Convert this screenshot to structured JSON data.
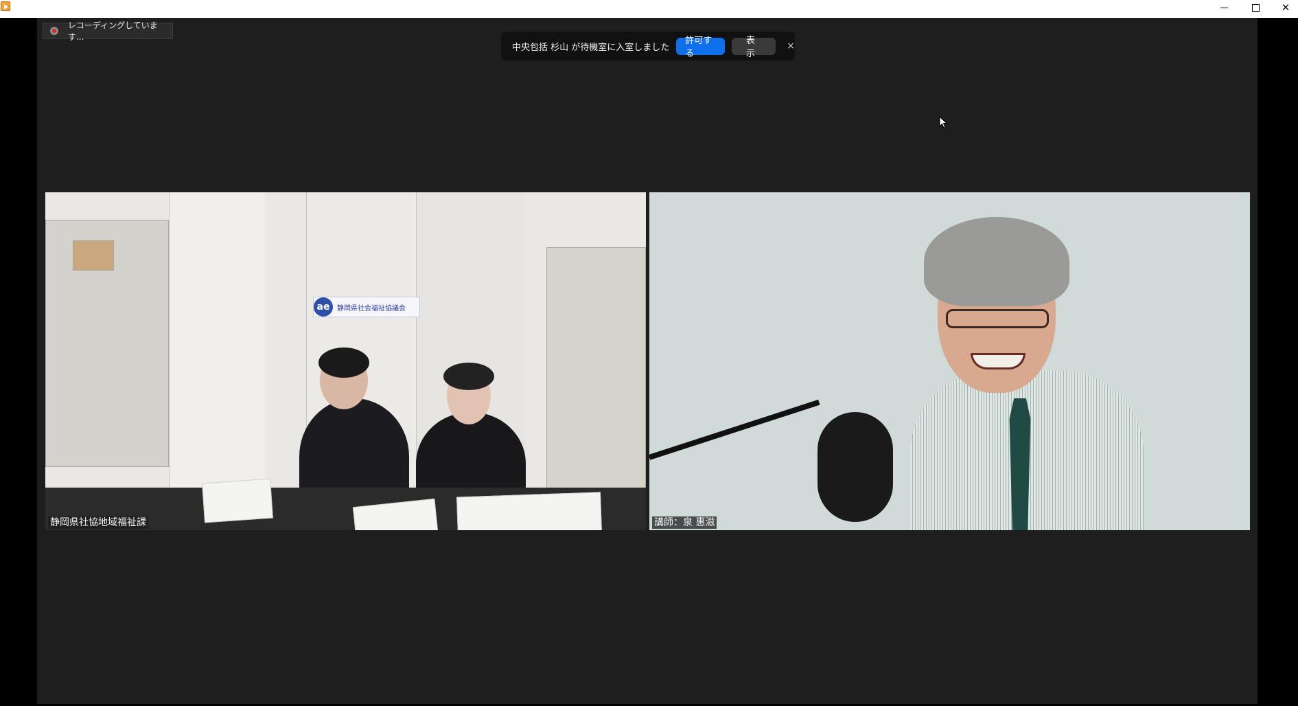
{
  "window": {
    "minimize_symbol": "",
    "maximize_symbol": "",
    "close_symbol": "✕"
  },
  "recording": {
    "label": "レコーディングしています..."
  },
  "waiting_room": {
    "message": "中央包括 杉山 が待機室に入室しました",
    "allow_label": "許可する",
    "view_label": "表示",
    "close_symbol": "×"
  },
  "participants": [
    {
      "name": "静岡県社協地域福祉課",
      "sign_text": "静岡県社会福祉協議会"
    },
    {
      "name": "講師：泉 惠滋"
    }
  ],
  "colors": {
    "accent": "#0e71eb",
    "meeting_bg": "#1e1e1e",
    "recording_dot": "#e0281e"
  }
}
